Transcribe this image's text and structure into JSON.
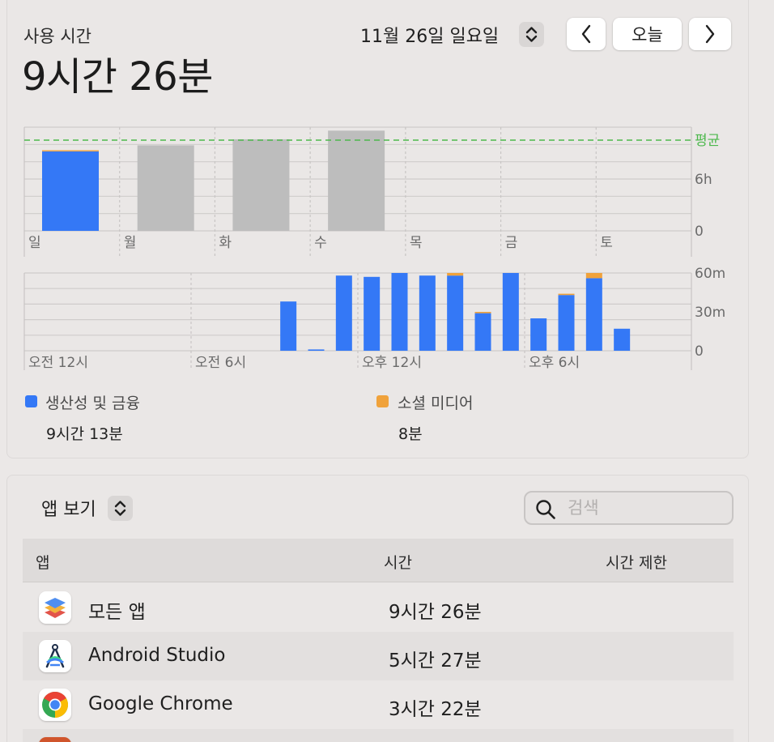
{
  "header": {
    "title": "사용 시간",
    "total": "9시간 26분",
    "date": "11월 26일 일요일",
    "today_label": "오늘"
  },
  "icons": {
    "date_stepper": "up-down-chevron-icon",
    "prev": "chevron-left-icon",
    "next": "chevron-right-icon",
    "view_stepper": "up-down-chevron-icon",
    "search": "magnifying-glass-icon",
    "all_apps": "stacked-layers-icon",
    "android_studio": "android-studio-icon",
    "chrome": "chrome-icon"
  },
  "colors": {
    "productivity": "#3478f6",
    "social": "#f0a23b",
    "past_day": "#bdbdbd",
    "average_line": "#4cb84c"
  },
  "chart_data": [
    {
      "type": "bar",
      "stacked": true,
      "categories": [
        "일",
        "월",
        "화",
        "수",
        "목",
        "금",
        "토"
      ],
      "series": [
        {
          "name": "생산성 및 금융",
          "values": [
            9.2,
            null,
            null,
            null,
            null,
            null,
            null
          ]
        },
        {
          "name": "소셜 미디어",
          "values": [
            0.13,
            null,
            null,
            null,
            null,
            null,
            null
          ]
        }
      ],
      "previous_days": [
        null,
        9.9,
        10.6,
        11.6,
        null,
        null,
        null
      ],
      "average": 10.5,
      "average_label": "평균",
      "yticks": [
        0,
        6
      ],
      "ytick_labels": [
        "0",
        "6h"
      ],
      "ylim": [
        0,
        12
      ],
      "grid": true
    },
    {
      "type": "bar",
      "stacked": true,
      "x": [
        9,
        10,
        11,
        12,
        13,
        14,
        15,
        16,
        17,
        18,
        19,
        20,
        21,
        22,
        23
      ],
      "xtick_labels": [
        "오전 12시",
        "오전 6시",
        "오후 12시",
        "오후 6시"
      ],
      "xtick_hours": [
        0,
        6,
        12,
        18
      ],
      "series": [
        {
          "name": "생산성 및 금융",
          "values": [
            38,
            1,
            58,
            57,
            60,
            58,
            58,
            29,
            60,
            25,
            43,
            56,
            17,
            null,
            null
          ]
        },
        {
          "name": "소셜 미디어",
          "values": [
            0,
            0,
            0,
            0,
            0,
            0,
            2,
            1,
            0,
            0,
            1,
            4,
            0,
            null,
            null
          ]
        }
      ],
      "yticks": [
        0,
        30,
        60
      ],
      "ytick_labels": [
        "0",
        "30m",
        "60m"
      ],
      "ylim": [
        0,
        60
      ],
      "grid": true
    }
  ],
  "legend": [
    {
      "label": "생산성 및 금융",
      "value": "9시간 13분"
    },
    {
      "label": "소셜 미디어",
      "value": "8분"
    }
  ],
  "apps_section": {
    "view_label": "앱 보기",
    "search_placeholder": "검색",
    "columns": [
      "앱",
      "시간",
      "시간 제한"
    ],
    "rows": [
      {
        "name": "모든 앱",
        "time": "9시간 26분"
      },
      {
        "name": "Android Studio",
        "time": "5시간 27분"
      },
      {
        "name": "Google Chrome",
        "time": "3시간 22분"
      }
    ]
  }
}
